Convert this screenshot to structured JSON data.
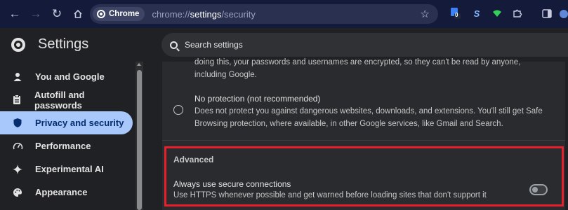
{
  "browser": {
    "chip_label": "Chrome",
    "url_prefix": "chrome://",
    "url_host": "settings",
    "url_path": "/security",
    "extension_badge": "0"
  },
  "header": {
    "title": "Settings",
    "search_placeholder": "Search settings"
  },
  "sidebar": {
    "items": [
      {
        "label": "You and Google",
        "icon": "person-icon"
      },
      {
        "label": "Autofill and passwords",
        "icon": "clipboard-icon"
      },
      {
        "label": "Privacy and security",
        "icon": "shield-icon",
        "active": true
      },
      {
        "label": "Performance",
        "icon": "speedometer-icon"
      },
      {
        "label": "Experimental AI",
        "icon": "sparkle-icon"
      },
      {
        "label": "Appearance",
        "icon": "palette-icon"
      }
    ]
  },
  "content": {
    "cut_text_line1": "doing this, your passwords and usernames are encrypted, so they can't be read by anyone,",
    "cut_text_line2": "including Google.",
    "no_protection_title": "No protection (not recommended)",
    "no_protection_line1": "Does not protect you against dangerous websites, downloads, and extensions. You'll still get Safe",
    "no_protection_line2": "Browsing protection, where available, in other Google services, like Gmail and Search.",
    "advanced_title": "Advanced",
    "https_title": "Always use secure connections",
    "https_desc": "Use HTTPS whenever possible and get warned before loading sites that don't support it",
    "https_enabled": false
  },
  "colors": {
    "toolbar_bg": "#141b3a",
    "active_nav_bg": "#a8c7fa",
    "highlight_border": "#e8202c"
  }
}
